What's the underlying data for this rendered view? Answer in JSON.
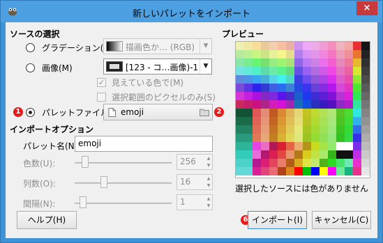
{
  "window": {
    "title": "新しいパレットをインポート",
    "close_glyph": "×"
  },
  "source_section": {
    "heading": "ソースの選択",
    "gradient_label": "グラデーション(G)",
    "gradient_combo": "描画色か… (RGB)",
    "image_label": "画像(M)",
    "image_combo": "[123 - コ…画像)-1",
    "visible_colors_label": "見えている色で(M)",
    "selection_only_label": "選択範囲のピクセルのみ(S)",
    "palette_file_label": "パレットファイル(F)",
    "palette_file_value": "emoji",
    "badge_1": "1",
    "badge_2": "2"
  },
  "import_options": {
    "heading": "インポートオプション",
    "palette_name_label": "パレット名(N):",
    "palette_name_value": "emoji",
    "colors_label": "色数(U):",
    "colors_value": "256",
    "columns_label": "列数(O):",
    "columns_value": "16",
    "interval_label": "間隔(N):",
    "interval_value": "1"
  },
  "preview": {
    "heading": "プレビュー",
    "status_text": "選択したソースには色がありません"
  },
  "buttons": {
    "help": "ヘルプ(H)",
    "import": "インポート(I)",
    "cancel": "キャンセル(C)",
    "badge_6": "6"
  },
  "colors": {
    "title_bar": "#4c9fe0",
    "close_button": "#c7393a",
    "badge": "#e51b1b",
    "dialog_bg": "#f0f0f0"
  }
}
